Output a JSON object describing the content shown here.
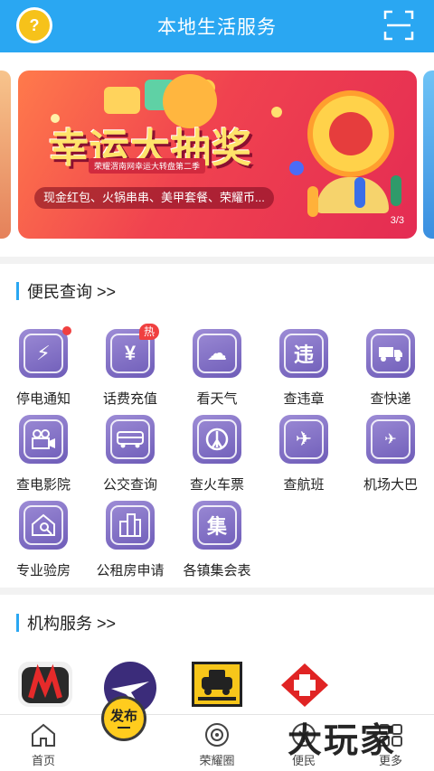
{
  "header": {
    "title": "本地生活服务",
    "avatar_icon": "question-badge-icon",
    "scan_icon": "scan-icon",
    "background": "#2aa7f2"
  },
  "banner": {
    "title": "幸运大抽奖",
    "subtitle": "荣耀渭南网幸运大转盘第二季",
    "prizes": "现金红包、火锅串串、美甲套餐、荣耀币...",
    "counter": "3/3"
  },
  "convenience": {
    "title": "便民查询 >>",
    "items": [
      {
        "label": "停电通知",
        "icon": "power-outage-icon",
        "badge": "dot"
      },
      {
        "label": "话费充值",
        "icon": "phone-recharge-icon",
        "badge": "热"
      },
      {
        "label": "看天气",
        "icon": "weather-icon"
      },
      {
        "label": "查违章",
        "icon": "violation-icon",
        "glyph": "违"
      },
      {
        "label": "查快递",
        "icon": "delivery-truck-icon"
      },
      {
        "label": "查电影院",
        "icon": "movie-camera-icon"
      },
      {
        "label": "公交查询",
        "icon": "bus-icon"
      },
      {
        "label": "查火车票",
        "icon": "train-icon"
      },
      {
        "label": "查航班",
        "icon": "airplane-icon"
      },
      {
        "label": "机场大巴",
        "icon": "airport-bus-icon"
      },
      {
        "label": "专业验房",
        "icon": "house-inspect-icon"
      },
      {
        "label": "公租房申请",
        "icon": "apartment-icon"
      },
      {
        "label": "各镇集会表",
        "icon": "market-icon",
        "glyph": "集"
      }
    ]
  },
  "institutions": {
    "title": "机构服务 >>",
    "items": [
      {
        "icon": "film-logo-icon"
      },
      {
        "icon": "airline-logo-icon"
      },
      {
        "icon": "taxi-icon"
      },
      {
        "icon": "red-cross-icon"
      }
    ]
  },
  "tabbar": {
    "tabs": [
      {
        "label": "首页",
        "icon": "home-icon"
      },
      {
        "label": "荣耀圈",
        "icon": "circle-icon"
      },
      {
        "label": "便民",
        "icon": "convenience-icon"
      },
      {
        "label": "更多",
        "icon": "more-icon"
      }
    ],
    "publish_label": "发布"
  },
  "watermark": "大玩家"
}
